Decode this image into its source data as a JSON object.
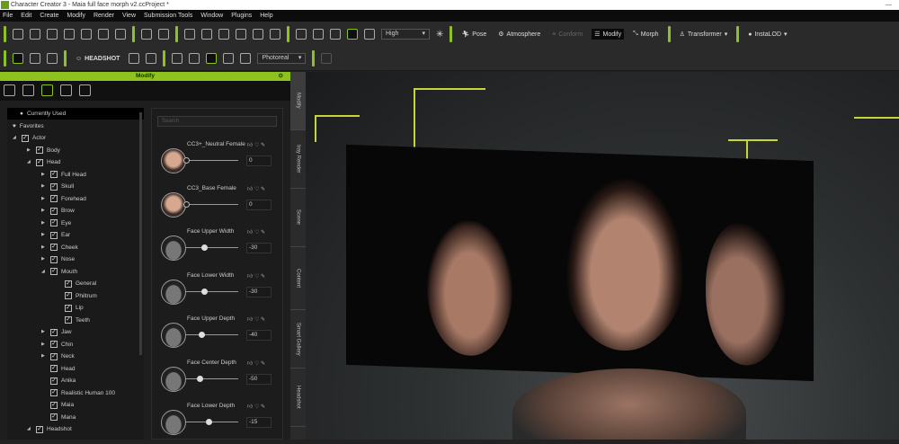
{
  "window": {
    "title": "Character Creator 3 - Maia full face morph v2.ccProject *"
  },
  "menu": [
    "File",
    "Edit",
    "Create",
    "Modify",
    "Render",
    "View",
    "Submission Tools",
    "Window",
    "Plugins",
    "Help"
  ],
  "toolbar1": {
    "quality": "High",
    "pose": "Pose",
    "atmosphere": "Atmosphere",
    "conform": "Conform",
    "modify": "Modify",
    "morph": "Morph",
    "transformer": "Transformer",
    "instalod": "InstaLOD"
  },
  "toolbar2": {
    "headshot": "HEADSHOT",
    "render_mode": "Photoreal"
  },
  "panel": {
    "title": "Modify"
  },
  "tree": [
    {
      "label": "Currently Used",
      "level": 0,
      "type": "dot",
      "selected": true
    },
    {
      "label": "Favorites",
      "level": 0,
      "type": "heart"
    },
    {
      "label": "Actor",
      "level": 0,
      "arrow": "open"
    },
    {
      "label": "Body",
      "level": 1,
      "arrow": "closed"
    },
    {
      "label": "Head",
      "level": 1,
      "arrow": "open"
    },
    {
      "label": "Full Head",
      "level": 2,
      "arrow": "closed"
    },
    {
      "label": "Skull",
      "level": 2,
      "arrow": "closed"
    },
    {
      "label": "Forehead",
      "level": 2,
      "arrow": "closed"
    },
    {
      "label": "Brow",
      "level": 2,
      "arrow": "closed"
    },
    {
      "label": "Eye",
      "level": 2,
      "arrow": "closed"
    },
    {
      "label": "Ear",
      "level": 2,
      "arrow": "closed"
    },
    {
      "label": "Cheek",
      "level": 2,
      "arrow": "closed"
    },
    {
      "label": "Nose",
      "level": 2,
      "arrow": "closed"
    },
    {
      "label": "Mouth",
      "level": 2,
      "arrow": "open"
    },
    {
      "label": "General",
      "level": 3
    },
    {
      "label": "Philtrum",
      "level": 3
    },
    {
      "label": "Lip",
      "level": 3
    },
    {
      "label": "Teeth",
      "level": 3
    },
    {
      "label": "Jaw",
      "level": 2,
      "arrow": "closed"
    },
    {
      "label": "Chin",
      "level": 2,
      "arrow": "closed"
    },
    {
      "label": "Neck",
      "level": 2,
      "arrow": "closed"
    },
    {
      "label": "Head",
      "level": 2
    },
    {
      "label": "Anika",
      "level": 2
    },
    {
      "label": "Realistic Human 100",
      "level": 2
    },
    {
      "label": "Maia",
      "level": 2
    },
    {
      "label": "Mana",
      "level": 2
    },
    {
      "label": "Headshot",
      "level": 1,
      "arrow": "open"
    }
  ],
  "morph": {
    "search_placeholder": "Search",
    "items": [
      {
        "name": "CC3+_Neutral Female",
        "value": "0",
        "thumb": "face",
        "slider": 0
      },
      {
        "name": "CC3_Base Female",
        "value": "0",
        "thumb": "face",
        "slider": 0
      },
      {
        "name": "Face Upper Width",
        "value": "-30",
        "thumb": "head",
        "slider": -30
      },
      {
        "name": "Face Lower Width",
        "value": "-30",
        "thumb": "head",
        "slider": -30
      },
      {
        "name": "Face Upper Depth",
        "value": "-40",
        "thumb": "head",
        "slider": -40
      },
      {
        "name": "Face Center Depth",
        "value": "-50",
        "thumb": "head",
        "slider": -50
      },
      {
        "name": "Face Lower Depth",
        "value": "-15",
        "thumb": "head",
        "slider": -15
      }
    ]
  },
  "side_tabs": [
    "Modify",
    "Iray Render",
    "Scene",
    "Content",
    "Smart Gallery",
    "Headshot"
  ],
  "colors": {
    "accent": "#8dc21f",
    "guides": "#c6d63a"
  }
}
